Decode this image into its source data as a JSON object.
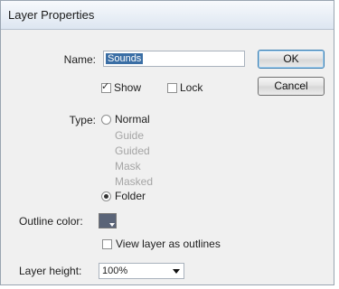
{
  "window": {
    "title": "Layer Properties"
  },
  "name": {
    "label": "Name:",
    "value": "Sounds"
  },
  "buttons": {
    "ok": "OK",
    "cancel": "Cancel"
  },
  "show": {
    "label": "Show",
    "checked": true
  },
  "lock": {
    "label": "Lock",
    "checked": false
  },
  "type": {
    "label": "Type:",
    "options": [
      "Normal",
      "Guide",
      "Guided",
      "Mask",
      "Masked",
      "Folder"
    ],
    "selected": "Folder",
    "disabled": [
      "Guide",
      "Guided",
      "Mask",
      "Masked"
    ]
  },
  "outline_color": {
    "label": "Outline color:",
    "color": "#5a6478"
  },
  "view_outlines": {
    "label": "View layer as outlines",
    "checked": false
  },
  "layer_height": {
    "label": "Layer height:",
    "value": "100%"
  }
}
